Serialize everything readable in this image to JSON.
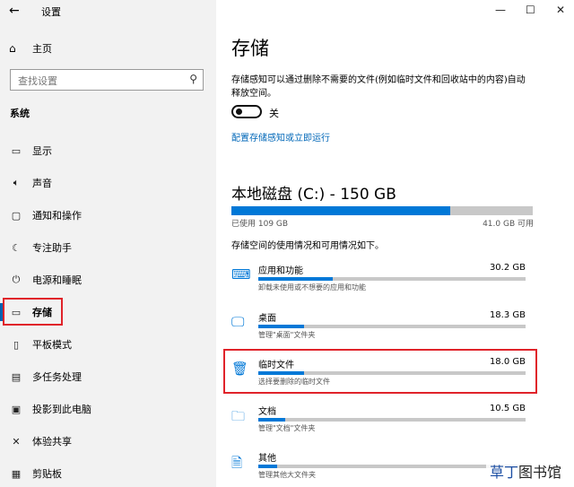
{
  "window": {
    "title": "设置",
    "back_icon": "←",
    "minimize": "—",
    "maximize": "☐",
    "close": "✕"
  },
  "sidebar": {
    "home": "主页",
    "search_placeholder": "查找设置",
    "section": "系统",
    "items": [
      {
        "label": "显示",
        "icon": "display-icon"
      },
      {
        "label": "声音",
        "icon": "sound-icon"
      },
      {
        "label": "通知和操作",
        "icon": "notification-icon"
      },
      {
        "label": "专注助手",
        "icon": "moon-icon"
      },
      {
        "label": "电源和睡眠",
        "icon": "power-icon"
      },
      {
        "label": "存储",
        "icon": "storage-icon",
        "active": true
      },
      {
        "label": "平板模式",
        "icon": "tablet-icon"
      },
      {
        "label": "多任务处理",
        "icon": "multitask-icon"
      },
      {
        "label": "投影到此电脑",
        "icon": "project-icon"
      },
      {
        "label": "体验共享",
        "icon": "share-icon"
      },
      {
        "label": "剪贴板",
        "icon": "clipboard-icon"
      }
    ]
  },
  "main": {
    "title": "存储",
    "description": "存储感知可以通过删除不需要的文件(例如临时文件和回收站中的内容)自动释放空间。",
    "toggle_label": "关",
    "toggle_on": false,
    "configure_link": "配置存储感知或立即运行",
    "disk_title": "本地磁盘 (C:) - 150 GB",
    "used": "已使用 109 GB",
    "available": "41.0 GB 可用",
    "used_fraction": 0.727,
    "usage_desc": "存储空间的使用情况和可用情况如下。",
    "categories": [
      {
        "name": "应用和功能",
        "size": "30.2 GB",
        "sub": "卸载未使用或不想要的应用和功能",
        "fraction": 0.28,
        "icon": "apps-icon"
      },
      {
        "name": "桌面",
        "size": "18.3 GB",
        "sub": "管理\"桌面\"文件夹",
        "fraction": 0.17,
        "icon": "desktop-icon"
      },
      {
        "name": "临时文件",
        "size": "18.0 GB",
        "sub": "选择要删除的临时文件",
        "fraction": 0.17,
        "icon": "trash-icon"
      },
      {
        "name": "文档",
        "size": "10.5 GB",
        "sub": "管理\"文档\"文件夹",
        "fraction": 0.1,
        "icon": "documents-icon"
      },
      {
        "name": "其他",
        "size": "",
        "sub": "管理其他大文件夹",
        "fraction": 0.07,
        "icon": "other-icon"
      }
    ]
  },
  "watermark": {
    "part1": "草丁",
    "part2": "图书馆"
  },
  "colors": {
    "accent": "#0078d7",
    "highlight_box": "#e0232a",
    "link": "#0067b8"
  }
}
